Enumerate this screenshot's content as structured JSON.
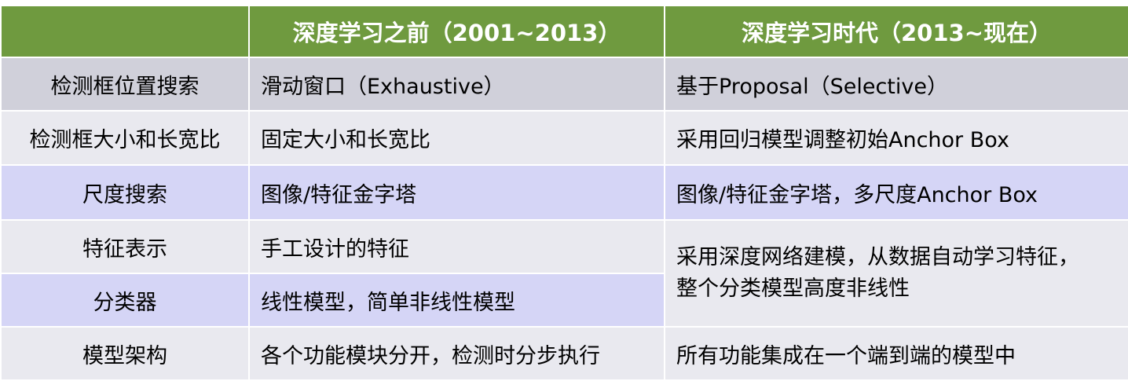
{
  "header": {
    "col0": "",
    "col1": "深度学习之前（2001~2013）",
    "col2": "深度学习时代（2013~现在）"
  },
  "rows": [
    {
      "label": "检测框位置搜索",
      "before": "滑动窗口（Exhaustive）",
      "after": "基于Proposal（Selective）"
    },
    {
      "label": "检测框大小和长宽比",
      "before": "固定大小和长宽比",
      "after": "采用回归模型调整初始Anchor Box"
    },
    {
      "label": "尺度搜索",
      "before": "图像/特征金字塔",
      "after": "图像/特征金字塔，多尺度Anchor Box"
    },
    {
      "label": "特征表示",
      "before": "手工设计的特征",
      "after_line1": "采用深度网络建模，从数据自动学习特征，",
      "after_line2": "整个分类模型高度非线性"
    },
    {
      "label": "分类器",
      "before": "线性模型，简单非线性模型"
    },
    {
      "label": "模型架构",
      "before": "各个功能模块分开，检测时分步执行",
      "after": "所有功能集成在一个端到端的模型中"
    }
  ],
  "colors": {
    "header_bg": "#6f9a3f",
    "row_dark": "#d0d0da",
    "row_light": "#e9e9ef",
    "row_blue": "#d5d5f6"
  }
}
